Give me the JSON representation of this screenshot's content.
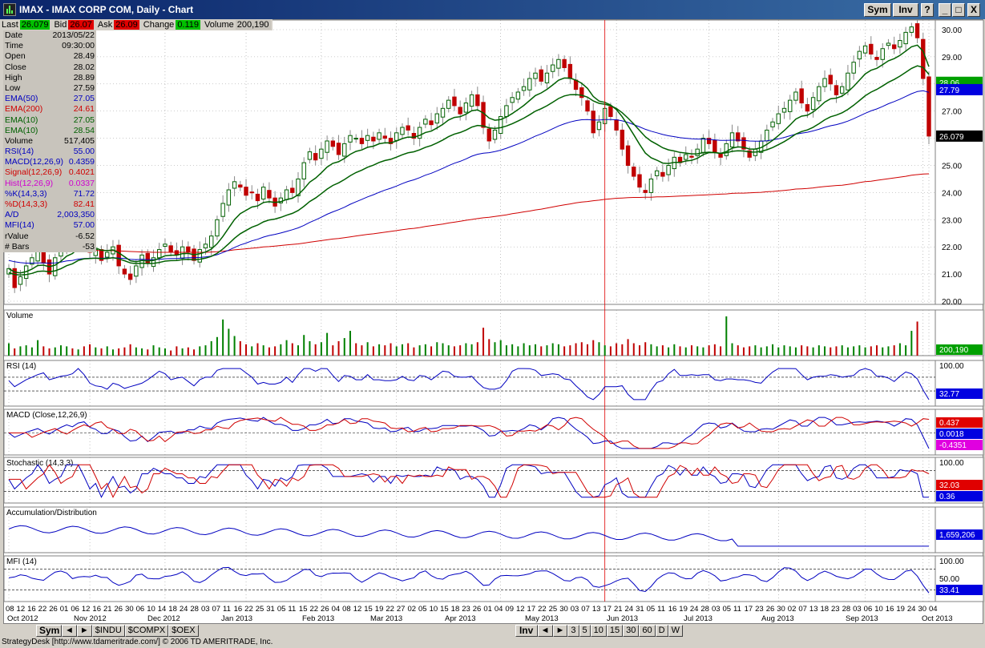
{
  "window": {
    "title": "IMAX - IMAX CORP COM, Daily - Chart",
    "sym_btn": "Sym",
    "inv_btn": "Inv",
    "help_btn": "?",
    "min_btn": "_",
    "max_btn": "□",
    "close_btn": "X"
  },
  "quote": [
    {
      "label": "Last",
      "value": "26.079",
      "color": "#00c000"
    },
    {
      "label": "Bid",
      "value": "26.07",
      "color": "#e00000"
    },
    {
      "label": "Ask",
      "value": "26.09",
      "color": "#e00000"
    },
    {
      "label": "Change",
      "value": "0.119",
      "color": "#00c000"
    },
    {
      "label": "Volume",
      "value": "200,190",
      "color": "#c8c4bc"
    }
  ],
  "info": [
    {
      "label": "Date",
      "value": "2013/05/22",
      "color": "#000000"
    },
    {
      "label": "Time",
      "value": "09:30:00",
      "color": "#000000"
    },
    {
      "label": "Open",
      "value": "28.49",
      "color": "#000000"
    },
    {
      "label": "Close",
      "value": "28.02",
      "color": "#000000"
    },
    {
      "label": "High",
      "value": "28.89",
      "color": "#000000"
    },
    {
      "label": "Low",
      "value": "27.59",
      "color": "#000000"
    },
    {
      "label": "EMA(50)",
      "value": "27.05",
      "color": "#0000c0"
    },
    {
      "label": "EMA(200)",
      "value": "24.61",
      "color": "#d00000"
    },
    {
      "label": "EMA(10)",
      "value": "27.05",
      "color": "#006000"
    },
    {
      "label": "EMA(10)",
      "value": "28.54",
      "color": "#006000"
    },
    {
      "label": "Volume",
      "value": "517,405",
      "color": "#000000"
    },
    {
      "label": "RSI(14)",
      "value": "55.00",
      "color": "#0000c0"
    },
    {
      "label": "MACD(12,26,9)",
      "value": "0.4359",
      "color": "#0000c0"
    },
    {
      "label": "Signal(12,26,9)",
      "value": "0.4021",
      "color": "#d00000"
    },
    {
      "label": "Hist(12,26,9)",
      "value": "0.0337",
      "color": "#d000d0"
    },
    {
      "label": "%K(14,3,3)",
      "value": "71.72",
      "color": "#0000c0"
    },
    {
      "label": "%D(14,3,3)",
      "value": "82.41",
      "color": "#d00000"
    },
    {
      "label": "A/D",
      "value": "2,003,350",
      "color": "#0000c0"
    },
    {
      "label": "MFI(14)",
      "value": "57.00",
      "color": "#0000c0"
    },
    {
      "label": "rValue",
      "value": "-6.52",
      "color": "#000000"
    },
    {
      "label": "# Bars",
      "value": "-53",
      "color": "#000000"
    }
  ],
  "chart_data": {
    "type": "candlestick",
    "symbol": "IMAX",
    "ylim": [
      20.0,
      30.0
    ],
    "price_ticks": [
      "30.00",
      "29.00",
      "28.00",
      "27.00",
      "26.00",
      "25.00",
      "24.00",
      "23.00",
      "22.00",
      "21.00",
      "20.00"
    ],
    "close": [
      21.2,
      20.5,
      20.9,
      21.3,
      21.6,
      21.9,
      21.4,
      21.0,
      21.6,
      22.1,
      22.5,
      22.2,
      22.8,
      22.3,
      21.8,
      21.9,
      21.5,
      21.8,
      22.0,
      21.3,
      21.0,
      20.8,
      21.3,
      21.7,
      21.4,
      21.6,
      21.9,
      22.1,
      21.8,
      21.7,
      22.0,
      21.8,
      21.5,
      21.9,
      22.1,
      22.4,
      23.0,
      23.6,
      24.1,
      24.4,
      24.2,
      23.9,
      24.0,
      23.7,
      24.2,
      23.8,
      23.5,
      23.8,
      24.1,
      24.0,
      24.5,
      25.1,
      25.5,
      25.2,
      25.6,
      25.9,
      25.7,
      25.4,
      25.8,
      26.1,
      26.0,
      25.8,
      26.1,
      25.9,
      26.2,
      26.0,
      25.8,
      26.2,
      26.4,
      26.3,
      26.0,
      26.4,
      26.7,
      26.5,
      26.9,
      27.1,
      27.4,
      27.2,
      26.9,
      27.3,
      27.6,
      27.2,
      26.4,
      25.9,
      26.3,
      26.8,
      27.2,
      27.5,
      27.7,
      27.9,
      28.2,
      28.4,
      28.1,
      28.4,
      28.7,
      28.9,
      28.6,
      28.2,
      27.8,
      27.5,
      27.0,
      26.2,
      26.6,
      27.1,
      26.8,
      26.3,
      25.6,
      25.0,
      24.6,
      24.2,
      24.0,
      24.5,
      24.8,
      24.6,
      25.0,
      25.3,
      25.1,
      25.4,
      25.3,
      25.6,
      26.0,
      25.8,
      25.5,
      25.3,
      25.8,
      26.2,
      25.9,
      25.6,
      25.3,
      25.6,
      25.9,
      26.3,
      26.6,
      26.9,
      27.1,
      27.4,
      27.7,
      27.3,
      27.0,
      27.5,
      27.9,
      28.2,
      28.0,
      27.6,
      27.9,
      28.4,
      28.8,
      29.2,
      29.4,
      29.1,
      28.9,
      29.3,
      29.5,
      29.3,
      29.6,
      29.9,
      30.1,
      29.7,
      28.2,
      26.08
    ],
    "ema50": [
      21.5,
      21.45,
      21.42,
      21.4,
      21.4,
      21.41,
      21.41,
      21.4,
      21.41,
      21.44,
      21.48,
      21.5,
      21.55,
      21.57,
      21.58,
      21.59,
      21.58,
      21.59,
      21.6,
      21.59,
      21.57,
      21.54,
      21.53,
      21.54,
      21.53,
      21.53,
      21.54,
      21.56,
      21.57,
      21.57,
      21.59,
      21.6,
      21.6,
      21.61,
      21.63,
      21.66,
      21.71,
      21.79,
      21.88,
      21.98,
      22.07,
      22.14,
      22.22,
      22.28,
      22.36,
      22.42,
      22.46,
      22.51,
      22.57,
      22.63,
      22.7,
      22.79,
      22.9,
      22.99,
      23.09,
      23.2,
      23.29,
      23.37,
      23.46,
      23.57,
      23.66,
      23.75,
      23.84,
      23.92,
      24.01,
      24.09,
      24.16,
      24.24,
      24.33,
      24.41,
      24.47,
      24.55,
      24.64,
      24.71,
      24.8,
      24.89,
      24.99,
      25.08,
      25.15,
      25.24,
      25.34,
      25.41,
      25.45,
      25.47,
      25.51,
      25.56,
      25.63,
      25.71,
      25.79,
      25.88,
      25.98,
      26.08,
      26.16,
      26.25,
      26.35,
      26.45,
      26.53,
      26.6,
      26.65,
      26.68,
      26.69,
      26.67,
      26.67,
      26.69,
      26.69,
      26.68,
      26.64,
      26.58,
      26.5,
      26.42,
      26.33,
      26.26,
      26.2,
      26.14,
      26.09,
      26.06,
      26.02,
      26.0,
      25.98,
      25.97,
      25.97,
      25.96,
      25.94,
      25.92,
      25.92,
      25.93,
      25.93,
      25.92,
      25.9,
      25.89,
      25.89,
      25.91,
      25.94,
      25.98,
      26.03,
      26.09,
      26.15,
      26.19,
      26.22,
      26.27,
      26.33,
      26.4,
      26.46,
      26.5,
      26.56,
      26.63,
      26.72,
      26.82,
      26.92,
      27.01,
      27.08,
      27.17,
      27.27,
      27.35,
      27.44,
      27.54,
      27.64,
      27.72,
      27.75,
      27.69
    ],
    "ema200": [
      21.9,
      21.88,
      21.87,
      21.86,
      21.86,
      21.86,
      21.86,
      21.85,
      21.85,
      21.85,
      21.86,
      21.86,
      21.87,
      21.87,
      21.87,
      21.87,
      21.86,
      21.86,
      21.86,
      21.85,
      21.84,
      21.83,
      21.82,
      21.81,
      21.81,
      21.8,
      21.8,
      21.8,
      21.8,
      21.8,
      21.8,
      21.8,
      21.8,
      21.8,
      21.8,
      21.81,
      21.82,
      21.84,
      21.86,
      21.89,
      21.91,
      21.93,
      21.95,
      21.97,
      22.0,
      22.01,
      22.03,
      22.05,
      22.07,
      22.09,
      22.11,
      22.14,
      22.17,
      22.2,
      22.23,
      22.26,
      22.29,
      22.31,
      22.34,
      22.37,
      22.4,
      22.43,
      22.46,
      22.48,
      22.51,
      22.54,
      22.57,
      22.6,
      22.63,
      22.66,
      22.68,
      22.71,
      22.75,
      22.78,
      22.81,
      22.84,
      22.88,
      22.91,
      22.94,
      22.98,
      23.01,
      23.04,
      23.07,
      23.09,
      23.12,
      23.15,
      23.18,
      23.22,
      23.25,
      23.29,
      23.32,
      23.36,
      23.39,
      23.43,
      23.47,
      23.51,
      23.55,
      23.58,
      23.62,
      23.65,
      23.67,
      23.7,
      23.72,
      23.75,
      23.77,
      23.79,
      23.8,
      23.81,
      23.82,
      23.82,
      23.83,
      23.83,
      23.84,
      23.84,
      23.85,
      23.86,
      23.87,
      23.88,
      23.89,
      23.9,
      23.91,
      23.92,
      23.93,
      23.94,
      23.95,
      23.97,
      23.98,
      23.98,
      23.99,
      24.0,
      24.01,
      24.03,
      24.04,
      24.06,
      24.08,
      24.1,
      24.13,
      24.14,
      24.15,
      24.17,
      24.2,
      24.22,
      24.24,
      24.26,
      24.27,
      24.3,
      24.33,
      24.37,
      24.4,
      24.42,
      24.45,
      24.48,
      24.51,
      24.54,
      24.57,
      24.6,
      24.64,
      24.66,
      24.68,
      24.69
    ],
    "volume": [
      1.2,
      0.7,
      0.9,
      1.0,
      0.8,
      1.5,
      0.9,
      0.7,
      0.8,
      1.0,
      0.9,
      0.7,
      0.6,
      0.9,
      1.1,
      0.8,
      0.7,
      0.9,
      0.6,
      0.7,
      0.8,
      1.1,
      0.8,
      0.7,
      0.6,
      1.0,
      0.8,
      0.7,
      0.5,
      0.9,
      0.7,
      0.8,
      0.6,
      0.9,
      1.0,
      1.4,
      1.8,
      3.5,
      2.6,
      1.9,
      1.4,
      1.1,
      0.9,
      1.2,
      1.0,
      0.8,
      0.9,
      1.1,
      1.5,
      1.2,
      1.0,
      2.0,
      1.4,
      1.1,
      1.3,
      2.2,
      1.0,
      1.4,
      1.7,
      2.4,
      1.2,
      1.0,
      1.3,
      0.9,
      1.1,
      1.0,
      1.2,
      0.9,
      1.1,
      1.2,
      0.8,
      1.0,
      1.1,
      0.9,
      1.3,
      1.2,
      1.0,
      0.9,
      1.0,
      1.2,
      1.1,
      1.3,
      2.7,
      1.6,
      1.3,
      1.5,
      1.0,
      1.1,
      0.9,
      1.2,
      1.0,
      1.1,
      0.9,
      1.0,
      1.2,
      1.1,
      0.9,
      1.0,
      1.2,
      1.3,
      1.1,
      1.5,
      1.3,
      1.0,
      0.9,
      1.2,
      1.1,
      1.6,
      1.2,
      1.0,
      1.3,
      1.1,
      0.9,
      1.0,
      0.8,
      1.1,
      0.9,
      0.8,
      1.0,
      0.9,
      0.8,
      1.0,
      1.1,
      0.9,
      3.8,
      1.2,
      1.0,
      0.8,
      0.9,
      1.0,
      0.8,
      0.9,
      1.1,
      0.8,
      1.0,
      0.9,
      0.8,
      1.0,
      0.9,
      0.8,
      1.0,
      0.9,
      0.8,
      0.9,
      1.0,
      0.8,
      0.9,
      1.0,
      0.8,
      0.9,
      1.0,
      0.8,
      0.9,
      1.0,
      1.2,
      1.0,
      2.4,
      3.3
    ],
    "volume_label": "Volume",
    "volume_value": "200,190",
    "rsi": {
      "label": "RSI (14)",
      "value": "32.77",
      "top_tick": "100.00"
    },
    "macd": {
      "label": "MACD (Close,12,26,9)",
      "values": [
        "0.437",
        "0.0018",
        "-0.4351"
      ]
    },
    "stoch": {
      "label": "Stochastic (14,3,3)",
      "values": [
        "32.03",
        "0.36"
      ],
      "top_tick": "100.00"
    },
    "ad": {
      "label": "Accumulation/Distribution",
      "value": "1,659,206"
    },
    "mfi": {
      "label": "MFI (14)",
      "value": "33.41",
      "top_tick": "100.00",
      "mid_tick": "50.00"
    },
    "x_day_ticks": [
      "08",
      "12",
      "16",
      "22",
      "26",
      "01",
      "06",
      "12",
      "16",
      "21",
      "26",
      "30",
      "06",
      "10",
      "14",
      "18",
      "24",
      "28",
      "03",
      "07",
      "11",
      "16",
      "22",
      "25",
      "31",
      "05",
      "11",
      "15",
      "22",
      "26",
      "04",
      "08",
      "12",
      "15",
      "19",
      "22",
      "27",
      "02",
      "05",
      "10",
      "15",
      "18",
      "23",
      "26",
      "01",
      "04",
      "09",
      "12",
      "17",
      "22",
      "25",
      "30",
      "03",
      "07",
      "13",
      "17",
      "21",
      "24",
      "31",
      "05",
      "11",
      "16",
      "19",
      "24",
      "28",
      "03",
      "05",
      "11",
      "17",
      "23",
      "26",
      "30",
      "02",
      "07",
      "13",
      "18",
      "23",
      "28",
      "03",
      "06",
      "10",
      "16",
      "19",
      "24",
      "30",
      "04"
    ],
    "x_month_ticks": [
      "Oct 2012",
      "Nov 2012",
      "Dec 2012",
      "Jan 2013",
      "Feb 2013",
      "Mar 2013",
      "Apr 2013",
      "May 2013",
      "Jun 2013",
      "Jul 2013",
      "Aug 2013",
      "Sep 2013",
      "Oct 2013"
    ],
    "last_price_labels": [
      {
        "value": "28.06",
        "color": "#00a000"
      },
      {
        "value": "27.79",
        "color": "#0000e0"
      },
      {
        "value": "26.079",
        "color": "#000000"
      }
    ],
    "crosshair_date": "2013/05/22"
  },
  "bottom": {
    "sym_btn": "Sym",
    "tabs": [
      "$INDU",
      "$COMPX",
      "$OEX"
    ],
    "inv_btn": "Inv",
    "periods": [
      "3",
      "5",
      "10",
      "15",
      "30",
      "60",
      "D",
      "W"
    ],
    "status": "StrategyDesk [http://www.tdameritrade.com/] © 2006 TD AMERITRADE, Inc."
  }
}
